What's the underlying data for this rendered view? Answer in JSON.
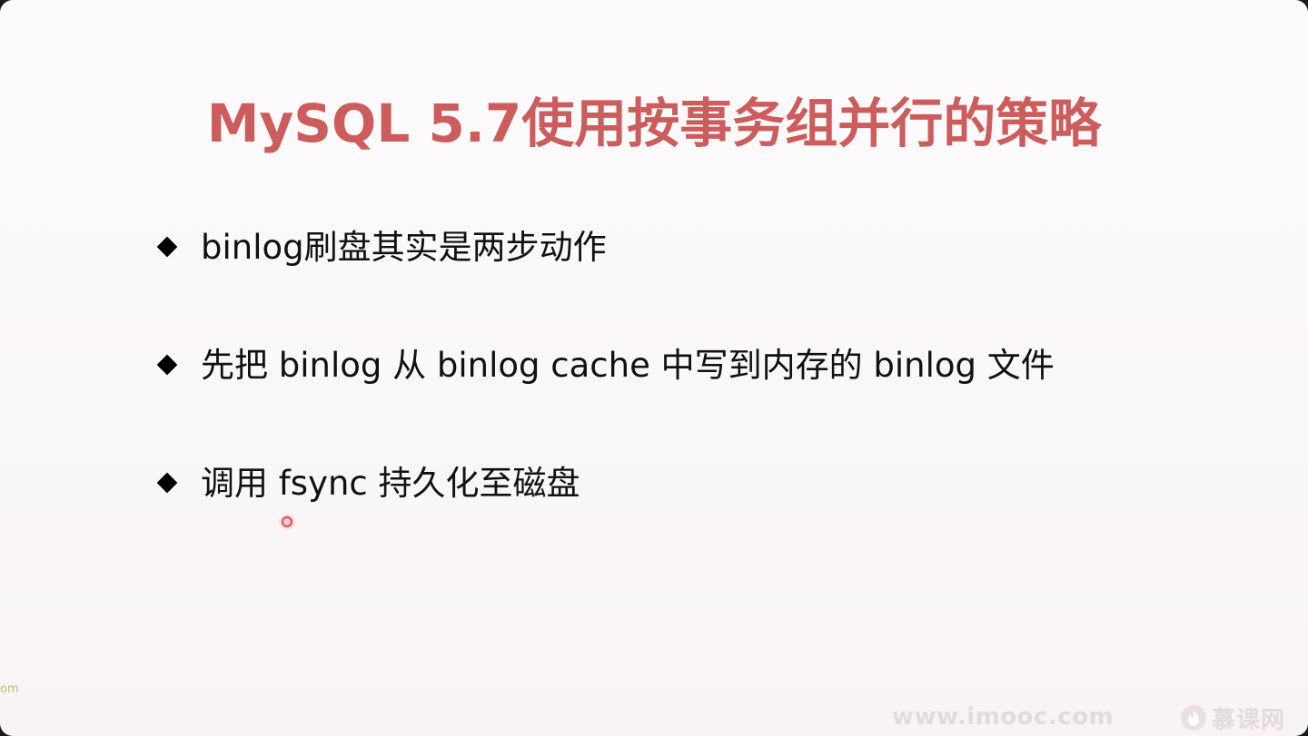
{
  "slide": {
    "title": "MySQL 5.7使用按事务组并行的策略",
    "bullets": [
      {
        "text": "binlog刷盘其实是两步动作"
      },
      {
        "text": "先把 binlog 从 binlog cache 中写到内存的 binlog 文件"
      },
      {
        "text": "调用 fsync 持久化至磁盘"
      }
    ]
  },
  "footer": {
    "left_edge_text": "om",
    "watermark": "www.imooc.com",
    "brand_name": "慕课网",
    "brand_icon": "flame-icon"
  },
  "colors": {
    "title": "#cd5c5c",
    "text": "#111111",
    "watermark": "#e4dadd",
    "cursor": "#e05050"
  }
}
